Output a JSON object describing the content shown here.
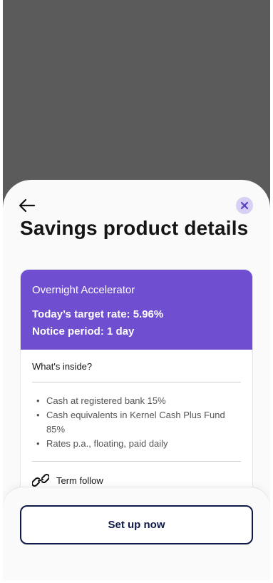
{
  "sheet": {
    "title": "Savings product details",
    "back_icon": "arrow-left-icon",
    "close_icon": "close-icon"
  },
  "product": {
    "name": "Overnight Accelerator",
    "rate_text": "Today’s target rate: 5.96%",
    "notice_text": "Notice period: 1 day",
    "accent_color": "#6f4fcf"
  },
  "inside": {
    "label": "What's inside?",
    "items": [
      "Cash at registered bank 15%",
      "Cash equivalents in Kernel Cash Plus Fund 85%",
      "Rates p.a., floating, paid daily"
    ]
  },
  "terms": {
    "label": "Term follow",
    "icon": "link-icon"
  },
  "footer": {
    "cta_label": "Set up now"
  }
}
